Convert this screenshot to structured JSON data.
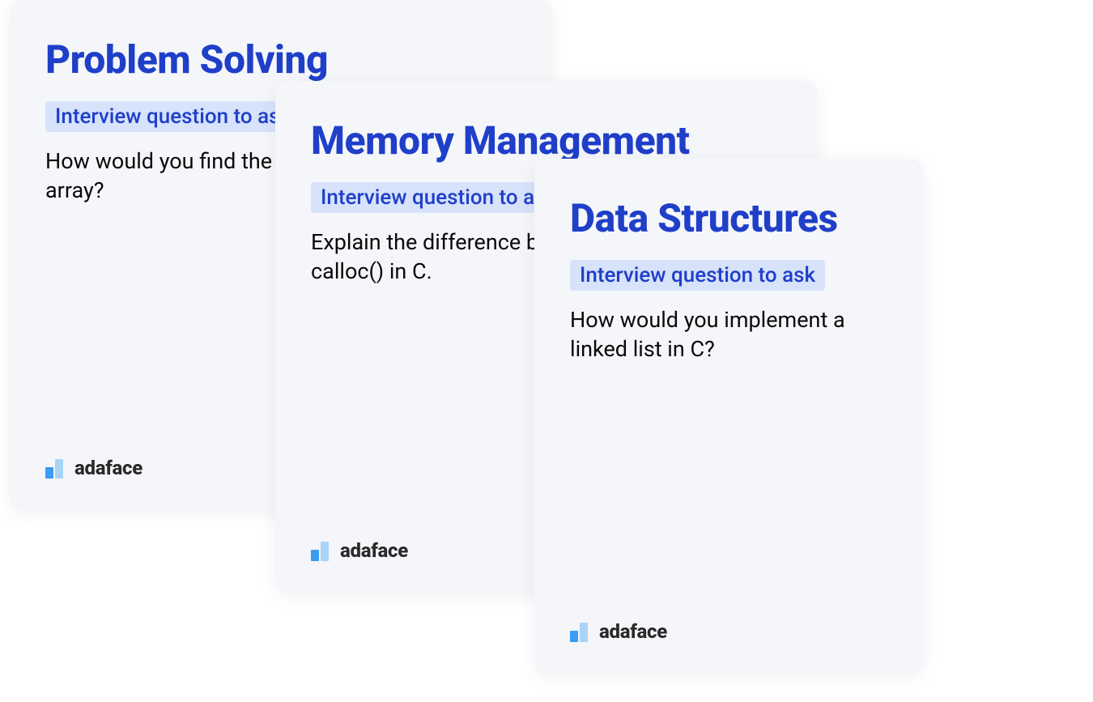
{
  "cards": [
    {
      "title": "Problem Solving",
      "badge": "Interview question to ask",
      "question": "How would you find the largest element in an array?",
      "logo": "adaface"
    },
    {
      "title": "Memory Management",
      "badge": "Interview question to ask",
      "question": "Explain the difference between malloc() and calloc() in C.",
      "logo": "adaface"
    },
    {
      "title": "Data Structures",
      "badge": "Interview question to ask",
      "question": "How would you implement a linked list in C?",
      "logo": "adaface"
    }
  ]
}
